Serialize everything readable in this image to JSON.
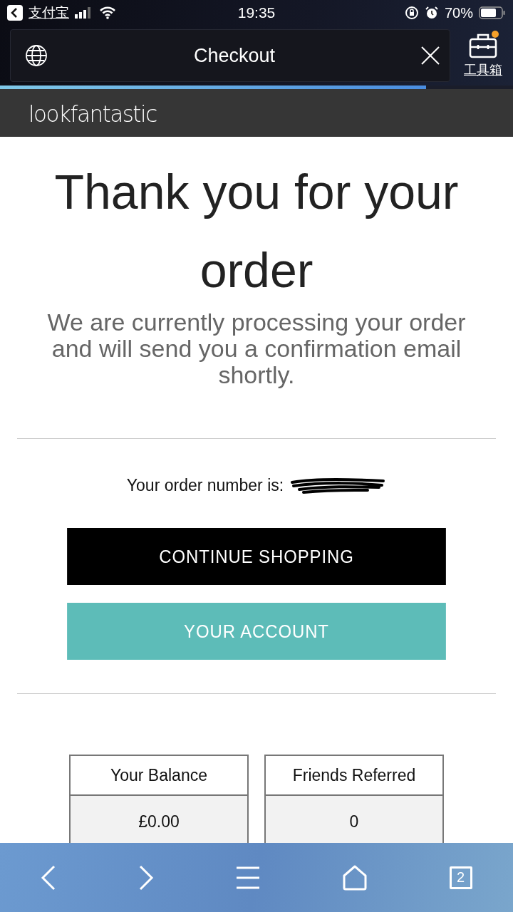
{
  "status_bar": {
    "back_app": "支付宝",
    "time": "19:35",
    "battery": "70%"
  },
  "address_bar": {
    "title": "Checkout",
    "toolbox_label": "工具箱",
    "toolbox_badge": true
  },
  "load_progress": {
    "level": 0.83
  },
  "site_header": {
    "logo": "lookfantastic"
  },
  "confirmation": {
    "heading": "Thank you for your order",
    "message": "We are currently processing your order and will send you a confirmation email shortly.",
    "order_number_label": "Your order number is:",
    "order_number_redacted": true
  },
  "buttons": [
    {
      "label": "CONTINUE SHOPPING",
      "kind": "primary"
    },
    {
      "label": "YOUR ACCOUNT",
      "kind": "secondary"
    }
  ],
  "stats": [
    {
      "label": "Your Balance",
      "value": "£0.00"
    },
    {
      "label": "Friends Referred",
      "value": "0"
    }
  ],
  "browser_toolbar": {
    "tab_count": "2"
  }
}
